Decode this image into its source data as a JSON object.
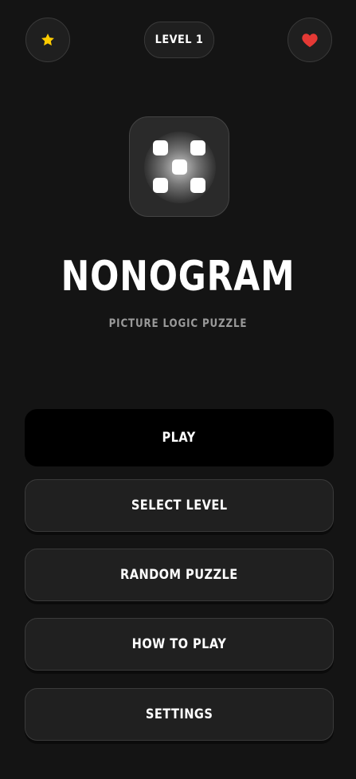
{
  "header": {
    "left_icon": "star-icon",
    "level_label": "LEVEL 1",
    "right_icon": "heart-icon"
  },
  "app": {
    "title": "NONOGRAM",
    "subtitle": "PICTURE LOGIC PUZZLE",
    "logo_icon": "dice-five-icon"
  },
  "menu": {
    "play": "PLAY",
    "select_level": "SELECT LEVEL",
    "random_puzzle": "RANDOM PUZZLE",
    "how_to_play": "HOW TO PLAY",
    "settings": "SETTINGS"
  },
  "colors": {
    "background": "#141414",
    "star": "#ffcc00",
    "heart": "#e53935",
    "primary_button": "#000000",
    "secondary_button": "#202020",
    "subtitle": "#9a9a9a"
  }
}
